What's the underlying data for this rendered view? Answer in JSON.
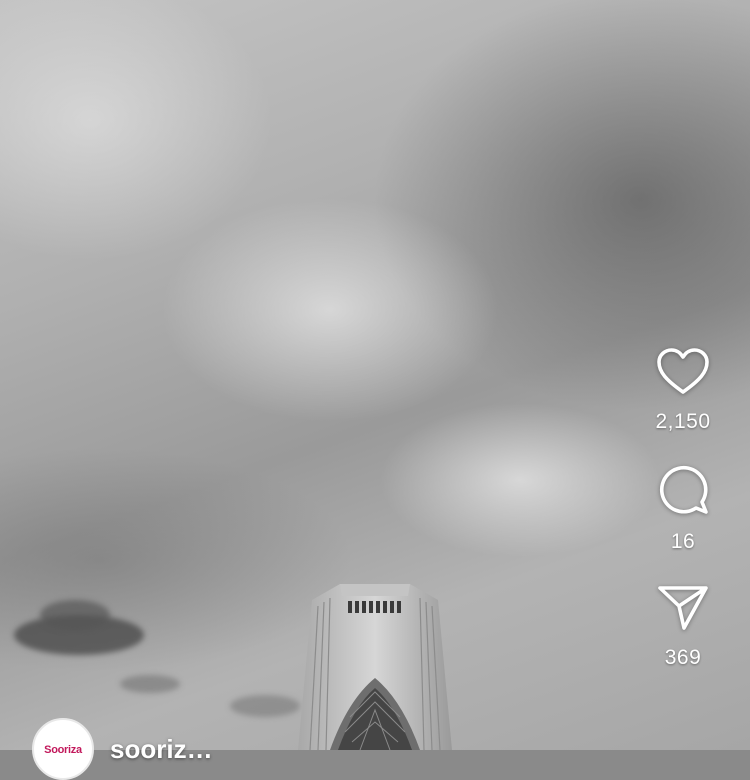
{
  "actions": {
    "like": {
      "icon": "heart-icon",
      "count": "2,150"
    },
    "comment": {
      "icon": "comment-bubble-icon",
      "count": "16"
    },
    "share": {
      "icon": "send-icon",
      "count": "369"
    }
  },
  "profile": {
    "username": "sooriz…",
    "avatar_text": "Sooriza"
  },
  "colors": {
    "icon": "#ffffff",
    "avatar_brand": "#c2185b"
  }
}
